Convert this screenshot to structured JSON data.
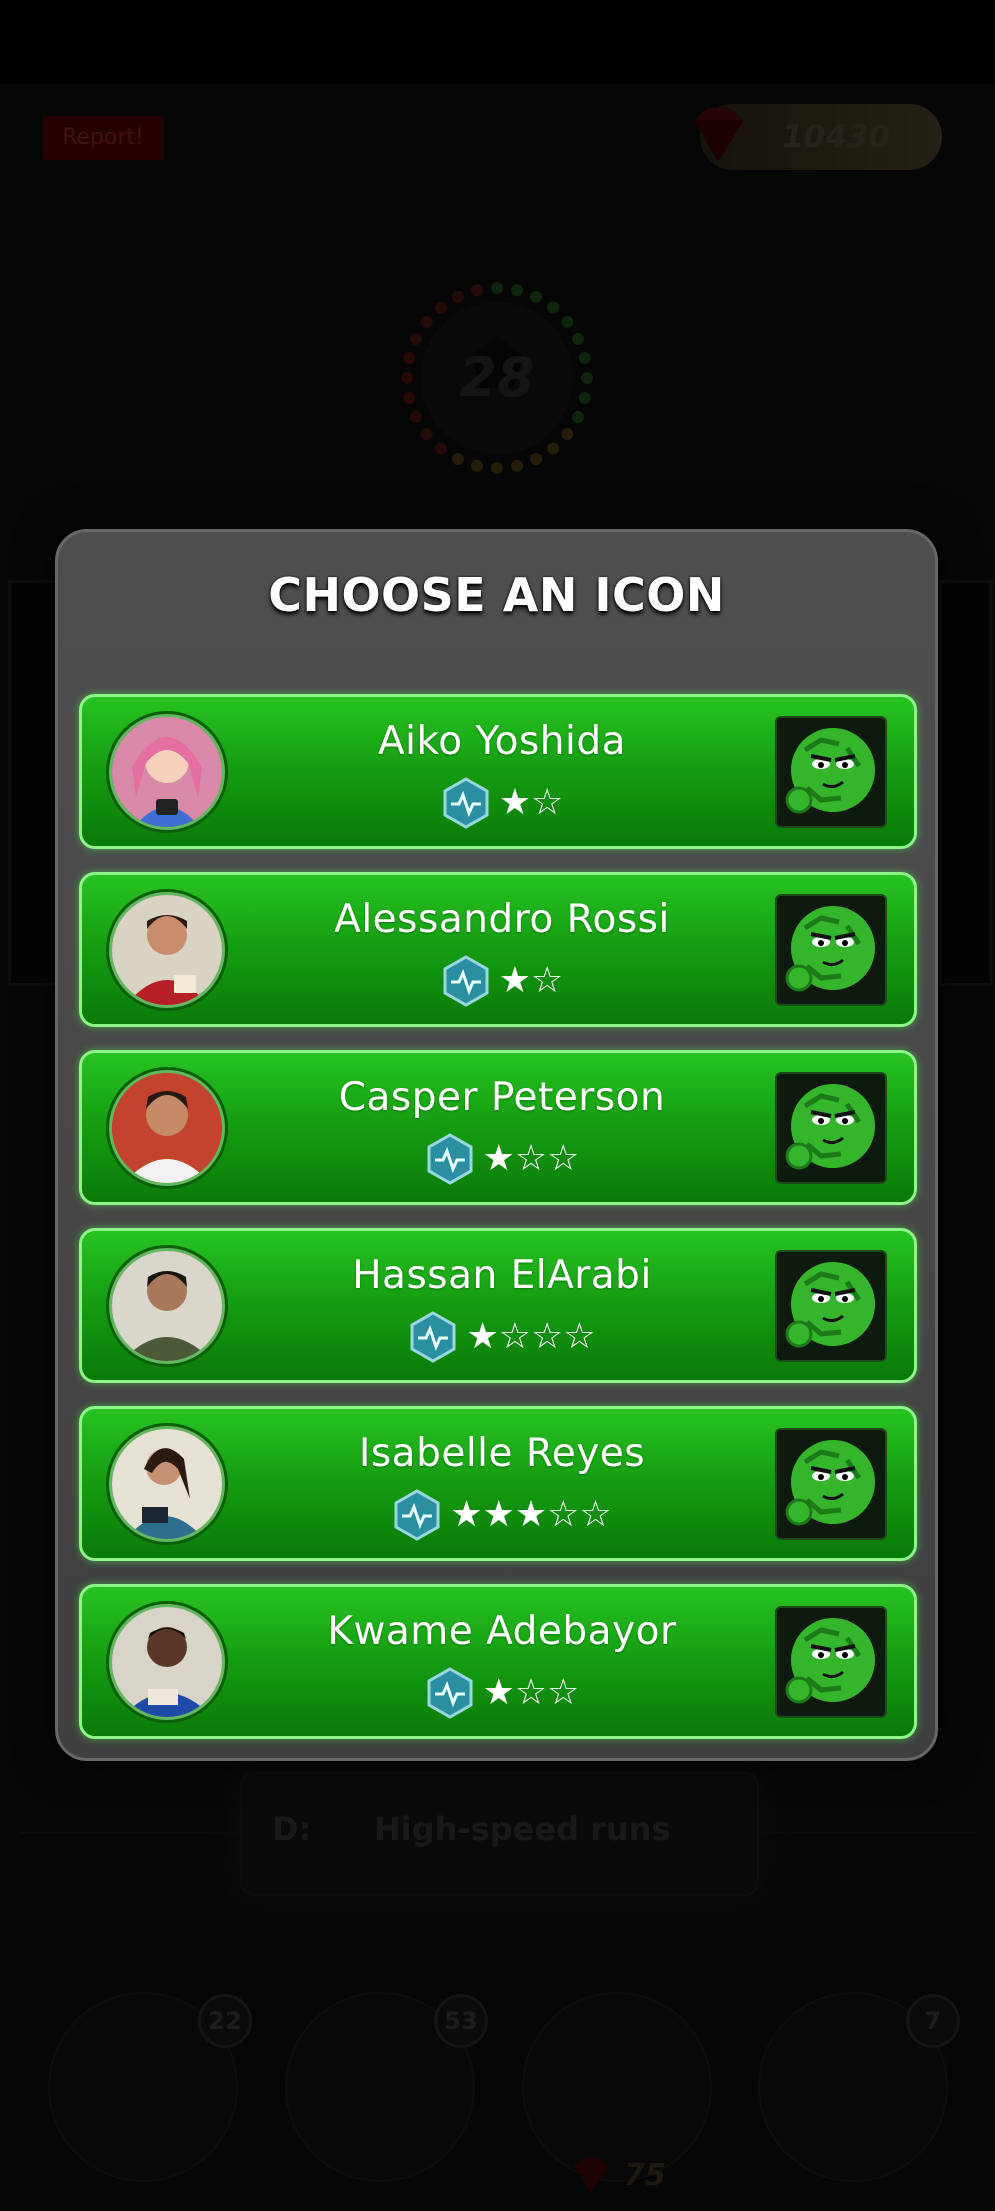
{
  "header": {
    "report_label": "Report!",
    "gem_balance": "10430",
    "timer_value": "28"
  },
  "background": {
    "hint_letter": "D:",
    "hint_text": "High-speed runs",
    "powerups": [
      {
        "name": "experts",
        "count": "22"
      },
      {
        "name": "phone-a-friend",
        "count": "53"
      },
      {
        "name": "crowd",
        "count": ""
      },
      {
        "name": "var",
        "count": "7"
      }
    ],
    "powerup_cost": "75"
  },
  "modal": {
    "title": "CHOOSE AN ICON",
    "items": [
      {
        "name": "Aiko Yoshida",
        "stars_filled": 1,
        "stars_total": 2,
        "stars_text": "★☆",
        "avatar_icon": "woman-camera-avatar"
      },
      {
        "name": "Alessandro Rossi",
        "stars_filled": 1,
        "stars_total": 2,
        "stars_text": "★☆",
        "avatar_icon": "man-red-jersey-avatar"
      },
      {
        "name": "Casper Peterson",
        "stars_filled": 1,
        "stars_total": 3,
        "stars_text": "★☆☆",
        "avatar_icon": "man-white-shirt-avatar"
      },
      {
        "name": "Hassan ElArabi",
        "stars_filled": 1,
        "stars_total": 4,
        "stars_text": "★☆☆☆",
        "avatar_icon": "man-military-avatar"
      },
      {
        "name": "Isabelle Reyes",
        "stars_filled": 3,
        "stars_total": 5,
        "stars_text": "★★★☆☆",
        "avatar_icon": "woman-tablet-avatar"
      },
      {
        "name": "Kwame Adebayor",
        "stars_filled": 1,
        "stars_total": 3,
        "stars_text": "★☆☆",
        "avatar_icon": "man-blue-jersey-avatar"
      }
    ],
    "emote_icon": "smug-football-emote-icon",
    "accent_color": "#1fb11a"
  }
}
